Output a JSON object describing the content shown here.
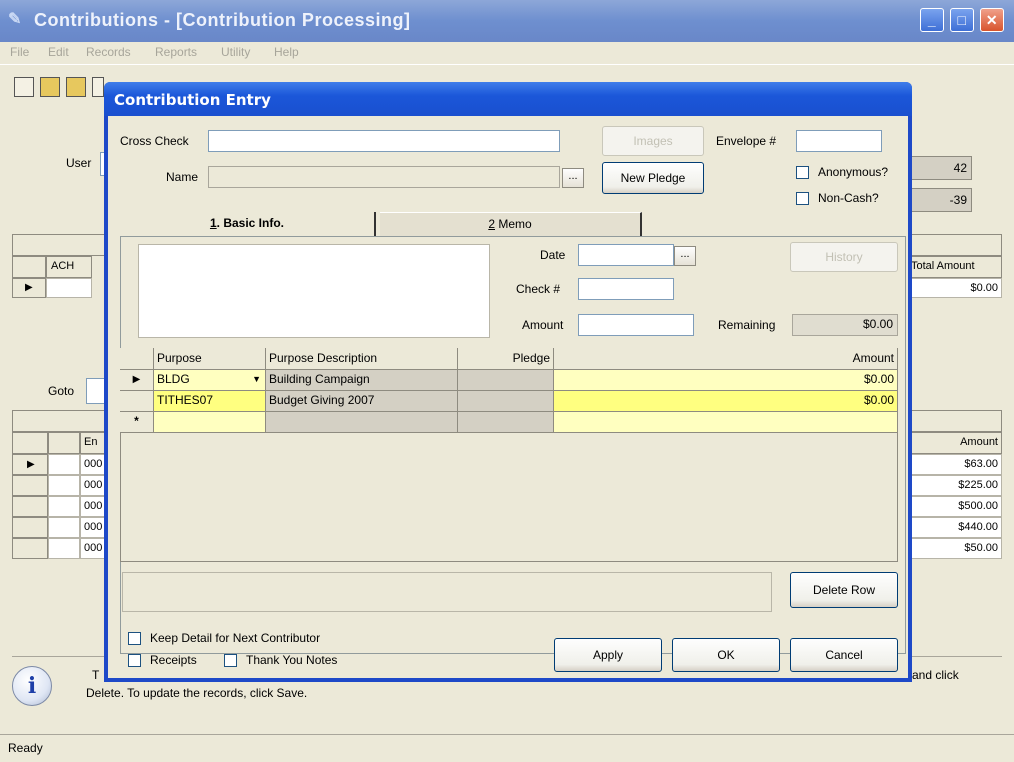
{
  "app": {
    "title": "Contributions - [Contribution Processing]",
    "menu": [
      "File",
      "Edit",
      "Records",
      "Reports",
      "Utility",
      "Help"
    ],
    "status": "Ready"
  },
  "background": {
    "user_label": "User",
    "goto_label": "Goto",
    "value_42": "42",
    "value_neg39": "-39",
    "top_grid": {
      "col_ach": "ACH",
      "col_total": "Total Amount",
      "total": "$0.00"
    },
    "bottom_grid": {
      "col_env": "En",
      "col_amount": "Amount",
      "rows": [
        {
          "env": "000",
          "amount": "$63.00"
        },
        {
          "env": "000",
          "amount": "$225.00"
        },
        {
          "env": "000",
          "amount": "$500.00"
        },
        {
          "env": "000",
          "amount": "$440.00"
        },
        {
          "env": "000",
          "amount": "$50.00"
        }
      ]
    },
    "hint_line1_start": "T",
    "hint_line1_end": "and click",
    "hint_line2": "Delete. To update the records, click Save."
  },
  "dialog": {
    "title": "Contribution Entry",
    "cross_check_label": "Cross Check",
    "cross_check_value": "",
    "name_label": "Name",
    "images_button": "Images",
    "new_pledge_button": "New Pledge",
    "envelope_label": "Envelope #",
    "anonymous_label": "Anonymous?",
    "noncash_label": "Non-Cash?",
    "tabs": [
      {
        "num": "1",
        "label": "Basic Info."
      },
      {
        "num": "2",
        "label": "Memo"
      }
    ],
    "date_label": "Date",
    "check_label": "Check #",
    "amount_label": "Amount",
    "history_button": "History",
    "remaining_label": "Remaining",
    "remaining_value": "$0.00",
    "grid": {
      "headers": [
        "Purpose",
        "Purpose Description",
        "Pledge",
        "Amount"
      ],
      "rows": [
        {
          "purpose": "BLDG",
          "description": "Building Campaign",
          "pledge": "",
          "amount": "$0.00"
        },
        {
          "purpose": "TITHES07",
          "description": "Budget Giving 2007",
          "pledge": "",
          "amount": "$0.00"
        }
      ],
      "new_row_marker": "*"
    },
    "delete_row_button": "Delete Row",
    "keep_detail_label": "Keep Detail for Next Contributor",
    "receipts_label": "Receipts",
    "thank_you_label": "Thank You Notes",
    "apply_button": "Apply",
    "ok_button": "OK",
    "cancel_button": "Cancel"
  }
}
